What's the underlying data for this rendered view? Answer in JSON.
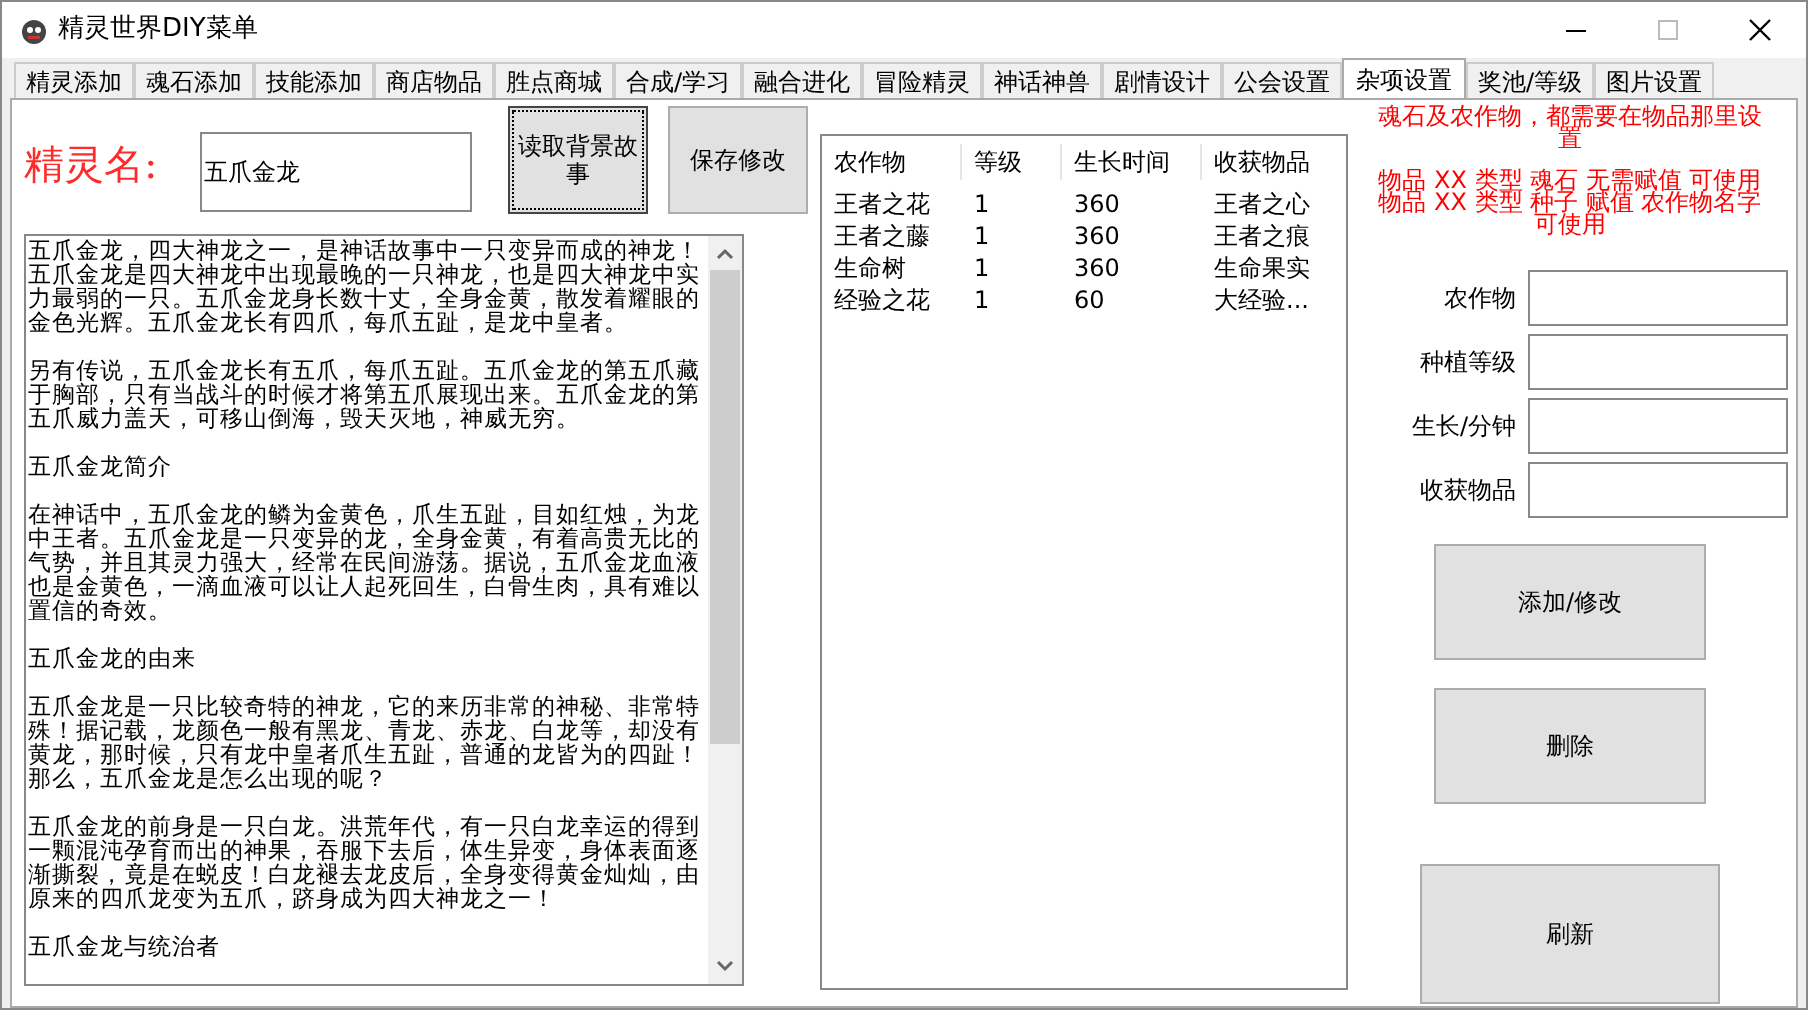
{
  "window": {
    "title": "精灵世界DIY菜单"
  },
  "tabs": [
    {
      "label": "精灵添加",
      "selected": false
    },
    {
      "label": "魂石添加",
      "selected": false
    },
    {
      "label": "技能添加",
      "selected": false
    },
    {
      "label": "商店物品",
      "selected": false
    },
    {
      "label": "胜点商城",
      "selected": false
    },
    {
      "label": "合成/学习",
      "selected": false
    },
    {
      "label": "融合进化",
      "selected": false
    },
    {
      "label": "冒险精灵",
      "selected": false
    },
    {
      "label": "神话神兽",
      "selected": false
    },
    {
      "label": "剧情设计",
      "selected": false
    },
    {
      "label": "公会设置",
      "selected": false
    },
    {
      "label": "杂项设置",
      "selected": true
    },
    {
      "label": "奖池/等级",
      "selected": false
    },
    {
      "label": "图片设置",
      "selected": false
    }
  ],
  "name_field": {
    "label": "精灵名:",
    "value": "五爪金龙"
  },
  "read_story_button": "读取背景故事",
  "save_button": "保存修改",
  "story": [
    "五爪金龙，四大神龙之一，是神话故事中一只变异而成的神龙！五爪金龙是四大神龙中出现最晚的一只神龙，也是四大神龙中实力最弱的一只。五爪金龙身长数十丈，全身金黄，散发着耀眼的金色光辉。五爪金龙长有四爪，每爪五趾，是龙中皇者。",
    "另有传说，五爪金龙长有五爪，每爪五趾。五爪金龙的第五爪藏于胸部，只有当战斗的时候才将第五爪展现出来。五爪金龙的第五爪威力盖天，可移山倒海，毁天灭地，神威无穷。",
    "五爪金龙简介",
    "在神话中，五爪金龙的鳞为金黄色，爪生五趾，目如红烛，为龙中王者。五爪金龙是一只变异的龙，全身金黄，有着高贵无比的气势，并且其灵力强大，经常在民间游荡。据说，五爪金龙血液也是金黄色，一滴血液可以让人起死回生，白骨生肉，具有难以置信的奇效。",
    "五爪金龙的由来",
    "五爪金龙是一只比较奇特的神龙，它的来历非常的神秘、非常特殊！据记载，龙颜色一般有黑龙、青龙、赤龙、白龙等，却没有黄龙，那时候，只有龙中皇者爪生五趾，普通的龙皆为的四趾！那么，五爪金龙是怎么出现的呢？",
    "五爪金龙的前身是一只白龙。洪荒年代，有一只白龙幸运的得到一颗混沌孕育而出的神果，吞服下去后，体生异变，身体表面逐渐撕裂，竟是在蜕皮！白龙褪去龙皮后，全身变得黄金灿灿，由原来的四爪龙变为五爪，跻身成为四大神龙之一！",
    "五爪金龙与统治者"
  ],
  "crop_table": {
    "columns": [
      "农作物",
      "等级",
      "生长时间",
      "收获物品"
    ],
    "rows": [
      [
        "王者之花",
        "1",
        "360",
        "王者之心"
      ],
      [
        "王者之藤",
        "1",
        "360",
        "王者之痕"
      ],
      [
        "生命树",
        "1",
        "360",
        "生命果实"
      ],
      [
        "经验之花",
        "1",
        "60",
        "大经验..."
      ]
    ]
  },
  "notes": [
    "魂石及农作物，都需要在物品那里设置",
    "物品 XX 类型 魂石 无需赋值 可使用",
    "物品 XX 类型 种子 赋值 农作物名字可使用"
  ],
  "form_fields": [
    {
      "label": "农作物"
    },
    {
      "label": "种植等级"
    },
    {
      "label": "生长/分钟"
    },
    {
      "label": "收获物品"
    }
  ],
  "buttons": [
    "添加/修改",
    "删除",
    "刷新"
  ]
}
